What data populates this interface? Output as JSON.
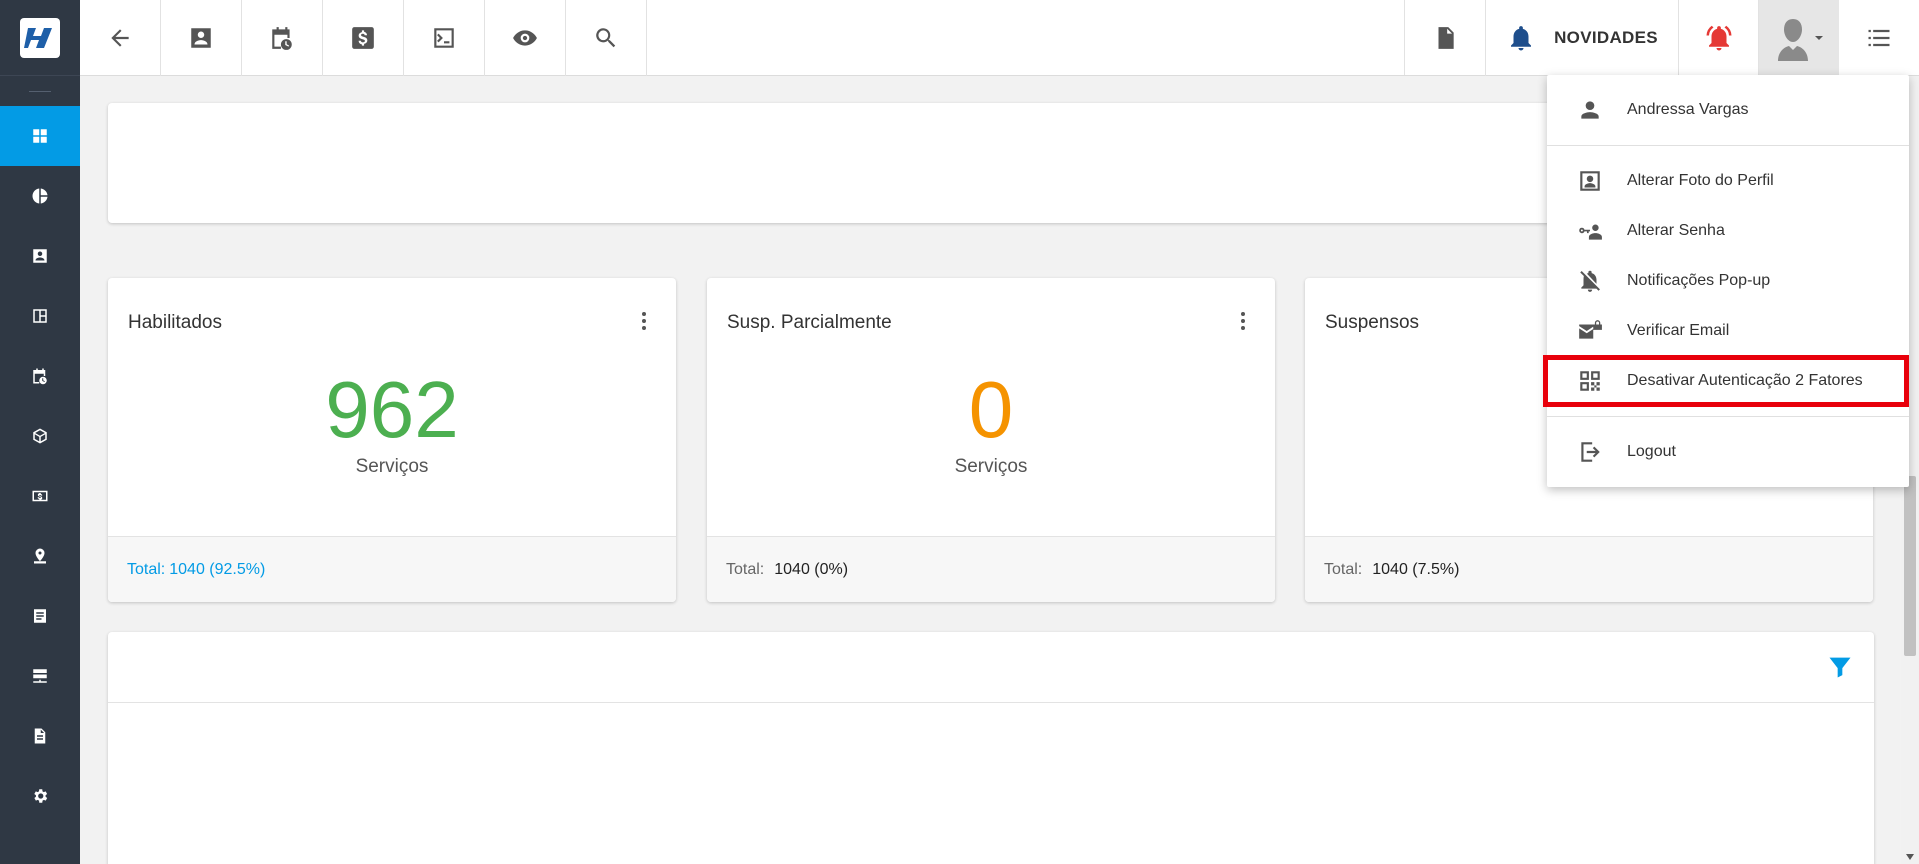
{
  "topbar": {
    "novidades_label": "NOVIDADES"
  },
  "cards": [
    {
      "title": "Habilitados",
      "value": "962",
      "value_color": "#4caf50",
      "sub": "Serviços",
      "foot_label": "Total:",
      "foot_value": "1040 (92.5%)",
      "foot_color": "#039be5"
    },
    {
      "title": "Susp. Parcialmente",
      "value": "0",
      "value_color": "#f59300",
      "sub": "Serviços",
      "foot_label": "Total:",
      "foot_value": "1040 (0%)"
    },
    {
      "title": "Suspensos",
      "value": "",
      "sub": "",
      "foot_label": "Total:",
      "foot_value": "1040 (7.5%)"
    }
  ],
  "user_menu": {
    "user_name": "Andressa Vargas",
    "items": [
      {
        "label": "Alterar Foto do Perfil",
        "icon": "portrait-icon"
      },
      {
        "label": "Alterar Senha",
        "icon": "key-user-icon"
      },
      {
        "label": "Notificações Pop-up",
        "icon": "bell-off-icon"
      },
      {
        "label": "Verificar Email",
        "icon": "email-lock-icon"
      },
      {
        "label": "Desativar Autenticação 2 Fatores",
        "icon": "qrcode-icon",
        "highlighted": true
      }
    ],
    "logout_label": "Logout"
  },
  "colors": {
    "sidebar_bg": "#2f3844",
    "accent": "#039be5",
    "highlight": "#e8000b",
    "alarm": "#e53935"
  }
}
